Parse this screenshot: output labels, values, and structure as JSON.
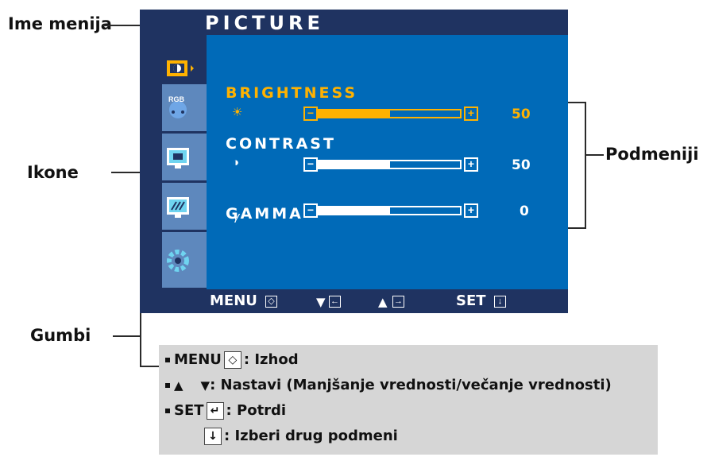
{
  "callouts": {
    "menu_name": "Ime menija",
    "icons": "Ikone",
    "buttons": "Gumbi",
    "submenus": "Podmeniji"
  },
  "osd": {
    "title": "PICTURE",
    "icons": [
      "picture-icon",
      "rgb-icon",
      "screen-position-icon",
      "sharpness-icon",
      "settings-gear-icon"
    ],
    "rgb_text": "RGB",
    "submenus": [
      {
        "label": "BRIGHTNESS",
        "icon": "sun-icon",
        "glyph": "☀",
        "value": "50",
        "level": 0.5,
        "label_color": "#ffb200",
        "selected": true
      },
      {
        "label": "CONTRAST",
        "icon": "contrast-icon",
        "glyph": "◑",
        "value": "50",
        "level": 0.5,
        "label_color": "#ffffff",
        "selected": false
      },
      {
        "label": "GAMMA",
        "icon": "gamma-icon",
        "glyph": "γ",
        "value": "0",
        "level": 0.5,
        "label_color": "#ffffff",
        "selected": false
      }
    ],
    "bar_minus": "−",
    "bar_plus": "+",
    "bottom": {
      "menu": "MENU",
      "down": "▼",
      "up": "▲",
      "set": "SET"
    }
  },
  "legend": {
    "row1_key": "MENU",
    "row1_text": ": Izhod",
    "row2_up": "▲",
    "row2_down": "▼",
    "row2_text": ": Nastavi (Manjšanje vrednosti/večanje vrednosti)",
    "row3_key": "SET",
    "row3_text": ": Potrdi",
    "row4_text": ": Izberi drug podmeni"
  },
  "colors": {
    "osd_blue": "#006ab8",
    "osd_dark": "#1f3361",
    "highlight": "#ffb200",
    "legend_bg": "#d6d6d6"
  }
}
